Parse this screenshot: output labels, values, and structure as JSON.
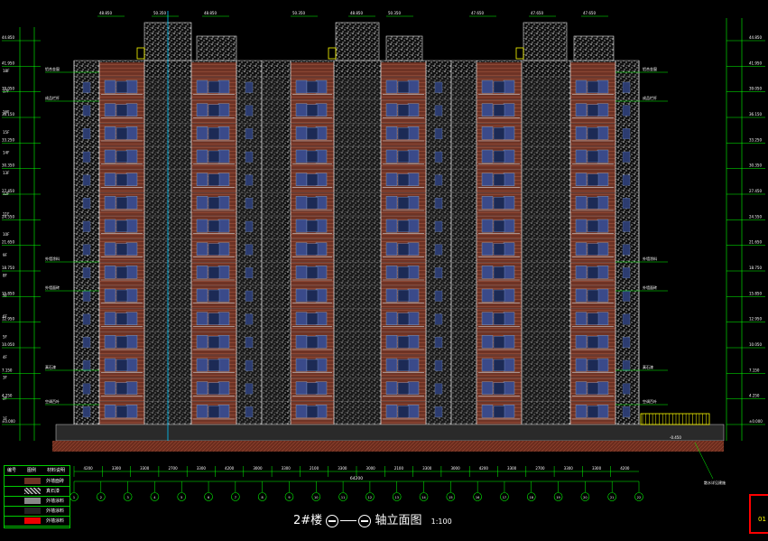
{
  "drawing": {
    "title_building": "2#楼",
    "title_suffix": "轴立面图",
    "scale": "1:100",
    "elevation_labels_left": [
      "44.850",
      "41.950",
      "39.050",
      "36.150",
      "33.250",
      "30.350",
      "27.450",
      "24.550",
      "21.650",
      "18.750",
      "15.850",
      "12.950",
      "10.050",
      "7.150",
      "4.250",
      "±0.000"
    ],
    "floor_labels_left": [
      "18F",
      "17F",
      "16F",
      "15F",
      "14F",
      "13F",
      "12F",
      "11F",
      "10F",
      "9F",
      "8F",
      "7F",
      "6F",
      "5F",
      "4F",
      "3F",
      "2F",
      "1F"
    ],
    "top_callouts": [
      "48.850",
      "50.350",
      "48.850",
      "50.350",
      "48.850",
      "50.350",
      "47.650",
      "47.650",
      "47.650"
    ],
    "side_callouts": [
      "成品栏杆",
      "外墙涂料",
      "外墙面砖",
      "真石漆",
      "空调百叶",
      "铝合金窗"
    ],
    "bottom_dims": [
      "4200",
      "3300",
      "3300",
      "2700",
      "3300",
      "4200",
      "3000",
      "3300",
      "2100",
      "3300",
      "3000",
      "2100",
      "3300",
      "3000",
      "4200",
      "3300",
      "2700",
      "3300",
      "3300",
      "4200"
    ],
    "total_dim": "64200",
    "axis_labels": [
      "1",
      "2",
      "3",
      "4",
      "5",
      "6",
      "7",
      "8",
      "9",
      "10",
      "11",
      "12",
      "13",
      "14",
      "15",
      "16",
      "17",
      "18",
      "19",
      "20",
      "21",
      "22"
    ],
    "legend": {
      "headers": [
        "编号",
        "图例",
        "材料说明"
      ],
      "rows": [
        "外墙面砖",
        "真石漆",
        "外墙涂料",
        "外墙涂料",
        "外墙涂料"
      ]
    },
    "ground_note": "-0.450",
    "ground_marker": "散水详见建施",
    "corner_mark": "01"
  },
  "colors": {
    "background": "#000000",
    "brick": "#7a3a2a",
    "stone": "#cfcfcf",
    "window": "#3a4a8a",
    "dimension": "#00ff00",
    "accent_red": "#ff0000",
    "railing": "#ffff00"
  }
}
